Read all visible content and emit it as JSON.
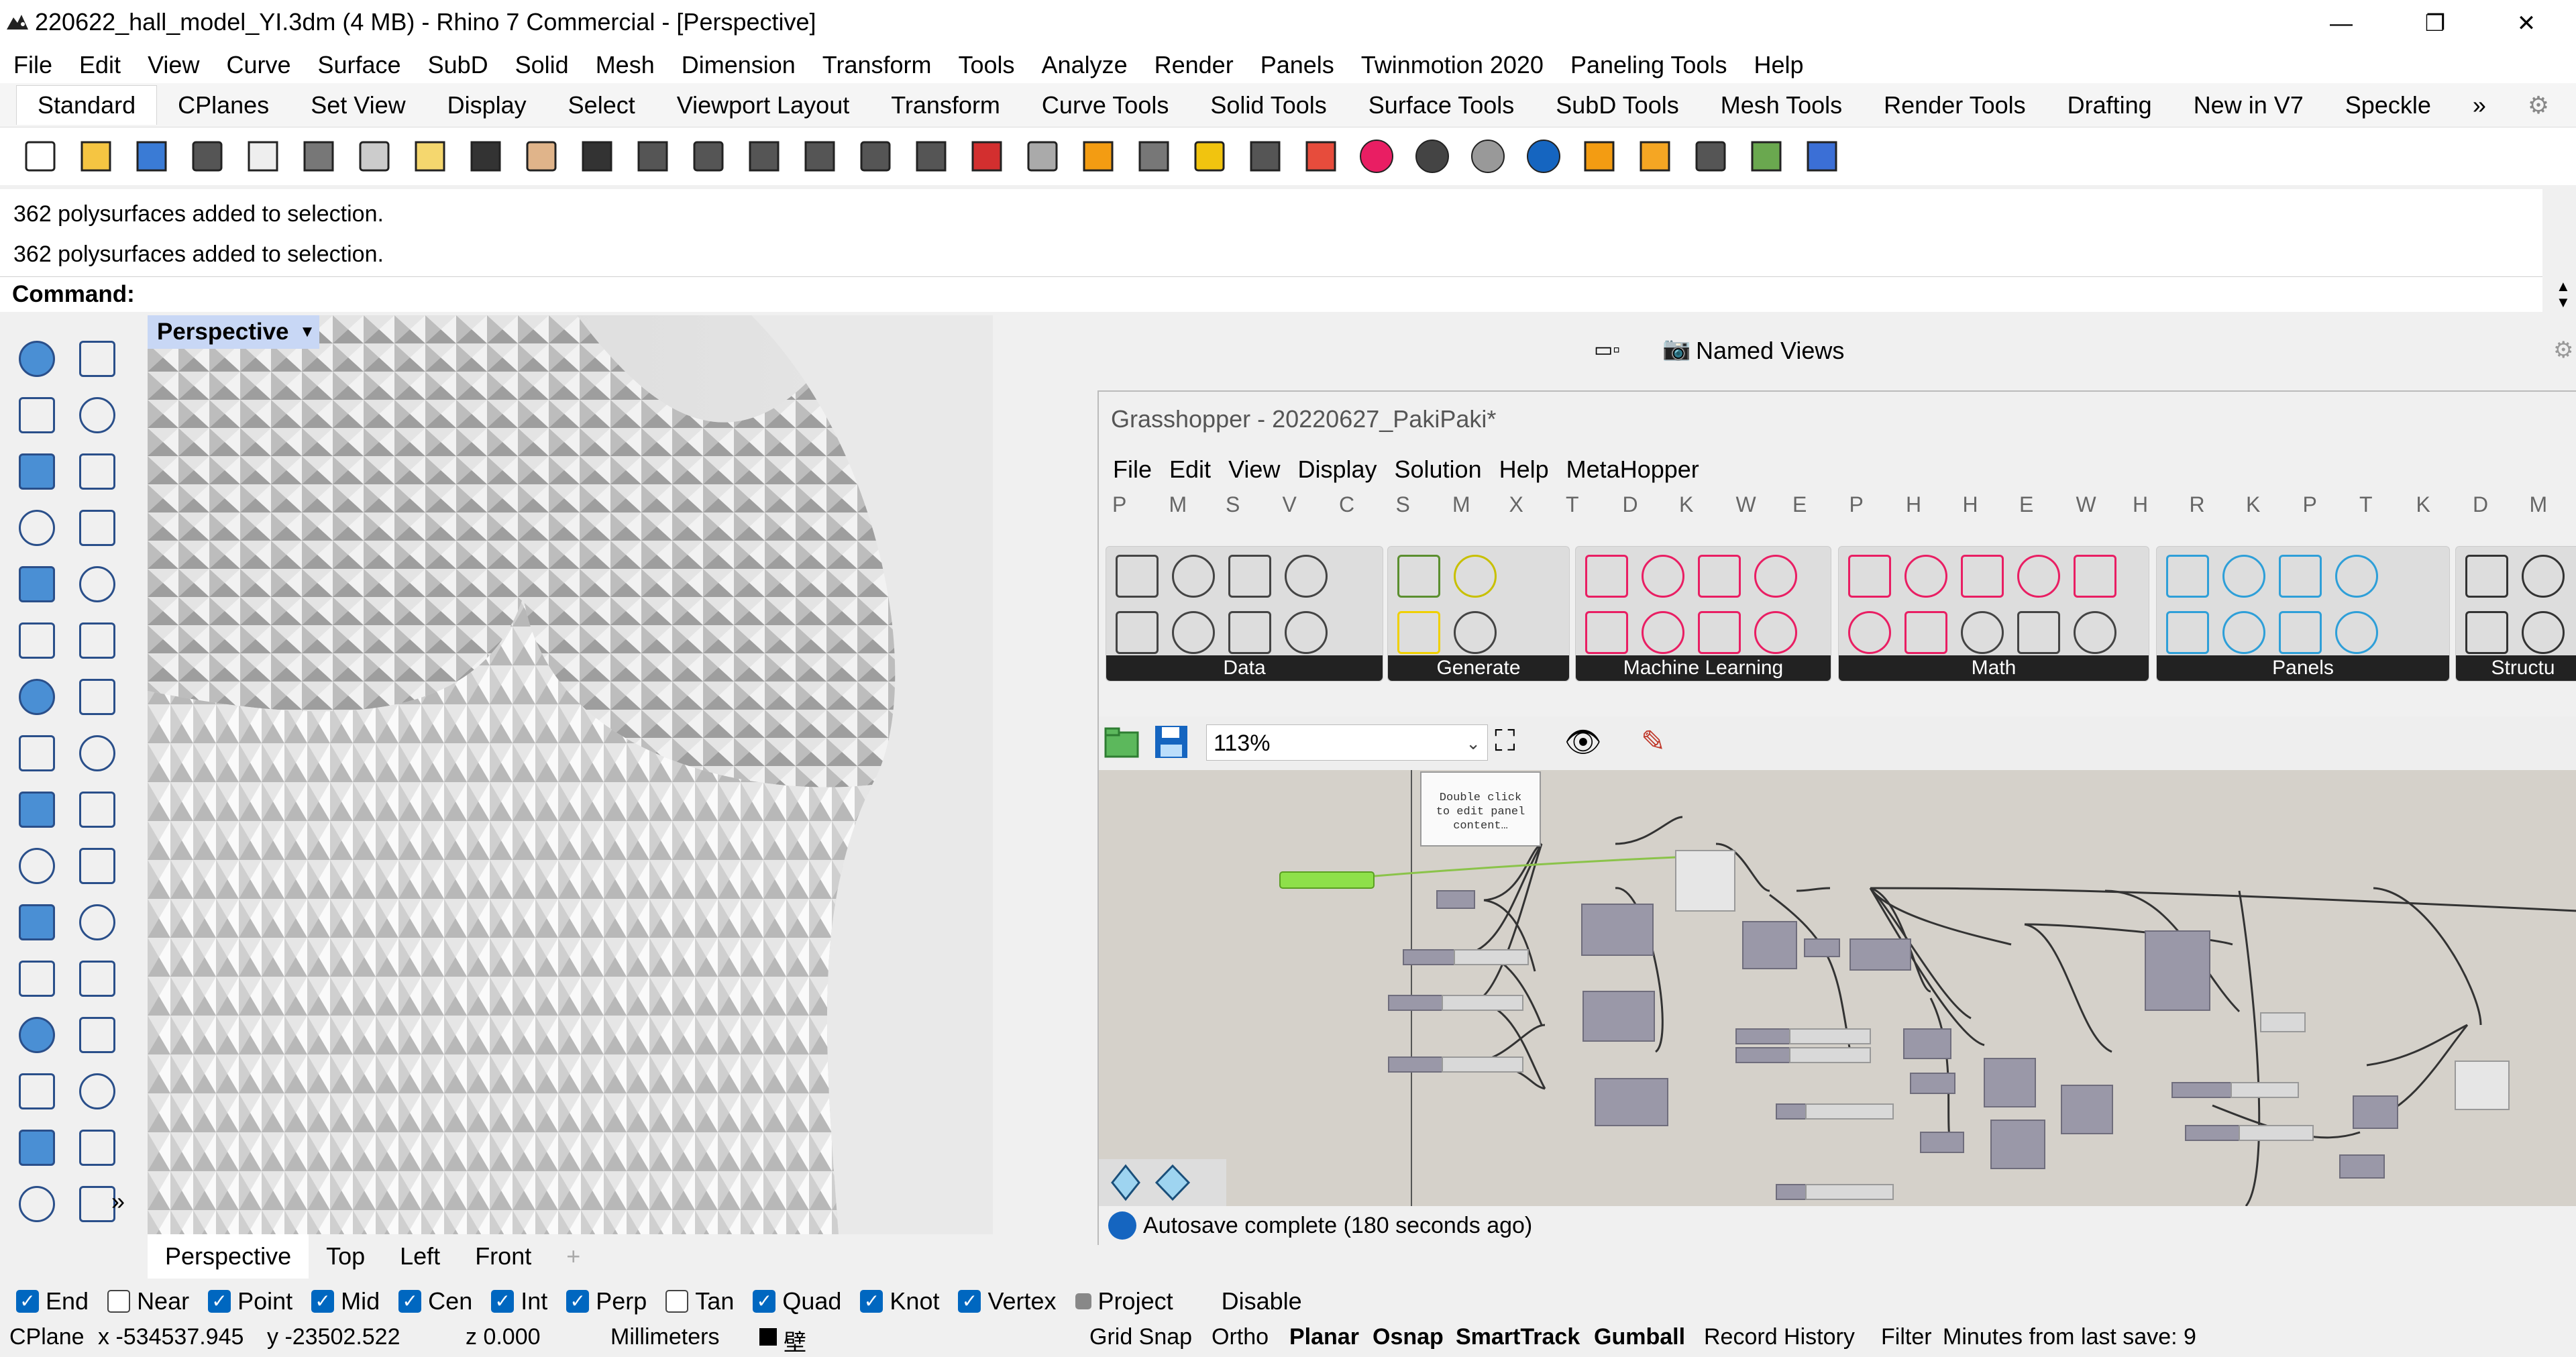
{
  "window": {
    "title": "220622_hall_model_YI.3dm (4 MB) - Rhino 7 Commercial - [Perspective]",
    "min_icon": "minimize-icon",
    "max_icon": "restore-icon",
    "close_icon": "close-icon"
  },
  "menu": [
    "File",
    "Edit",
    "View",
    "Curve",
    "Surface",
    "SubD",
    "Solid",
    "Mesh",
    "Dimension",
    "Transform",
    "Tools",
    "Analyze",
    "Render",
    "Panels",
    "Twinmotion 2020",
    "Paneling Tools",
    "Help"
  ],
  "tabs": [
    "Standard",
    "CPlanes",
    "Set View",
    "Display",
    "Select",
    "Viewport Layout",
    "Transform",
    "Curve Tools",
    "Solid Tools",
    "Surface Tools",
    "SubD Tools",
    "Mesh Tools",
    "Render Tools",
    "Drafting",
    "New in V7",
    "Speckle"
  ],
  "tabs_more": "»",
  "command": {
    "history": [
      "362 polysurfaces added to selection.",
      "362 polysurfaces added to selection."
    ],
    "label": "Command:",
    "value": ""
  },
  "viewport": {
    "title": "Perspective",
    "tabs": [
      "Perspective",
      "Top",
      "Left",
      "Front"
    ],
    "add_tab": "+"
  },
  "panel": {
    "named_views": "Named Views"
  },
  "grasshopper": {
    "title": "Grasshopper - 20220627_PakiPaki*",
    "menu": [
      "File",
      "Edit",
      "View",
      "Display",
      "Solution",
      "Help",
      "MetaHopper"
    ],
    "letters": [
      "P",
      "M",
      "S",
      "V",
      "C",
      "S",
      "M",
      "X",
      "T",
      "D",
      "K",
      "W",
      "E",
      "P",
      "H",
      "H",
      "E",
      "W",
      "H",
      "R",
      "K",
      "P",
      "T",
      "K",
      "D",
      "M"
    ],
    "groups": [
      "Data",
      "Generate",
      "Machine Learning",
      "Math",
      "Panels",
      "Structu"
    ],
    "zoom": "113%",
    "panel_note": "Double click to edit panel content…",
    "status": "Autosave complete (180 seconds ago)"
  },
  "osnaps": [
    {
      "label": "End",
      "state": "on"
    },
    {
      "label": "Near",
      "state": "off"
    },
    {
      "label": "Point",
      "state": "on"
    },
    {
      "label": "Mid",
      "state": "on"
    },
    {
      "label": "Cen",
      "state": "on"
    },
    {
      "label": "Int",
      "state": "on"
    },
    {
      "label": "Perp",
      "state": "on"
    },
    {
      "label": "Tan",
      "state": "off"
    },
    {
      "label": "Quad",
      "state": "on"
    },
    {
      "label": "Knot",
      "state": "on"
    },
    {
      "label": "Vertex",
      "state": "on"
    },
    {
      "label": "Project",
      "state": "grey"
    },
    {
      "label": "Disable",
      "state": "none"
    }
  ],
  "status": {
    "cplane": "CPlane",
    "x": "x -534537.945",
    "y": "y -23502.522",
    "z": "z 0.000",
    "units": "Millimeters",
    "layer": "壁",
    "grid_snap": "Grid Snap",
    "ortho": "Ortho",
    "planar": "Planar",
    "osnap": "Osnap",
    "smarttrack": "SmartTrack",
    "gumball": "Gumball",
    "record_history": "Record History",
    "filter": "Filter",
    "minutes": "Minutes from last save: 9"
  },
  "colors": {
    "accent": "#0067c0",
    "viewport_title_bg": "#c8d7f5",
    "gh_canvas": "#d5d1ca",
    "gh_component": "#9a98a8"
  }
}
